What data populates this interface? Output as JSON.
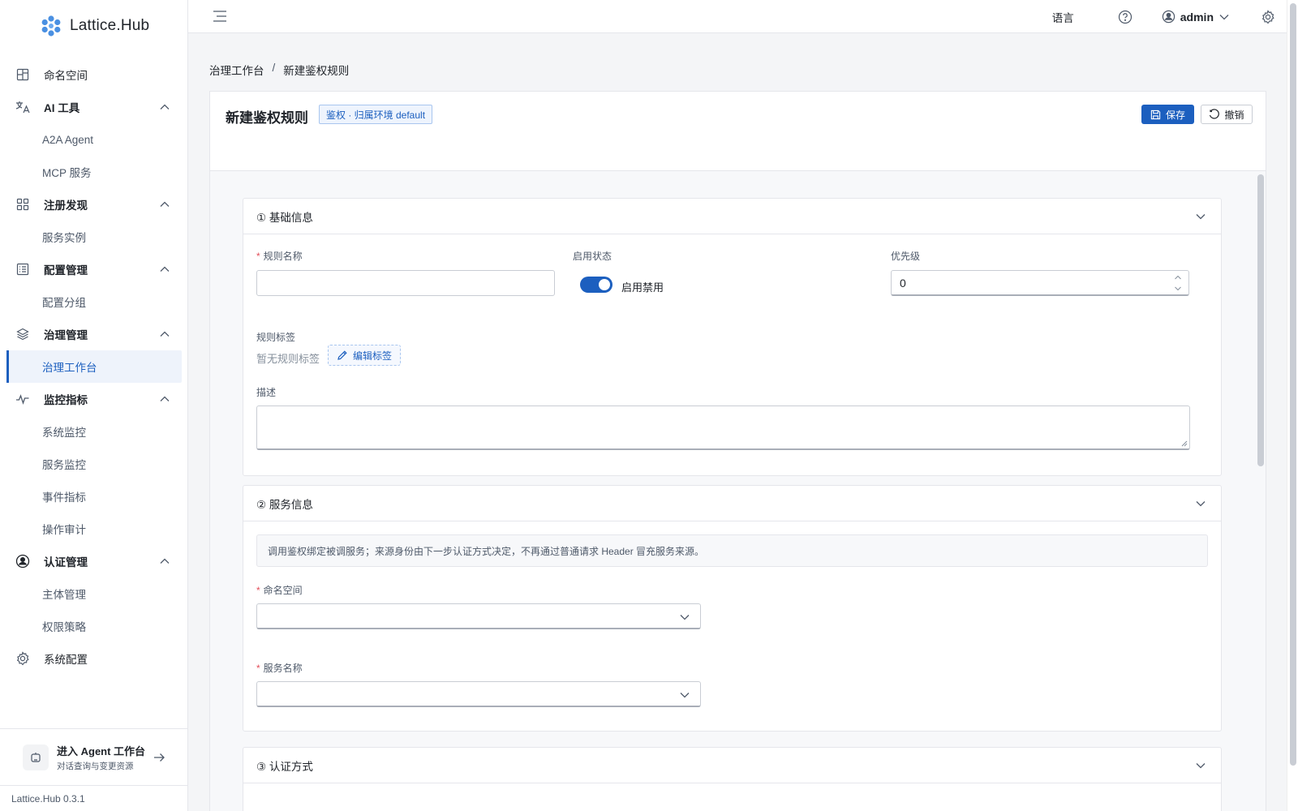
{
  "app": {
    "name": "Lattice.Hub",
    "version": "Lattice.Hub 0.3.1"
  },
  "sidebar": {
    "items": [
      {
        "label": "命名空间",
        "icon": "grid-icon",
        "type": "item"
      },
      {
        "label": "AI 工具",
        "icon": "translate-icon",
        "type": "group"
      },
      {
        "label": "A2A Agent",
        "type": "sub"
      },
      {
        "label": "MCP 服务",
        "type": "sub"
      },
      {
        "label": "注册发现",
        "icon": "apps-icon",
        "type": "group"
      },
      {
        "label": "服务实例",
        "type": "sub"
      },
      {
        "label": "配置管理",
        "icon": "list-icon",
        "type": "group"
      },
      {
        "label": "配置分组",
        "type": "sub"
      },
      {
        "label": "治理管理",
        "icon": "layers-icon",
        "type": "group"
      },
      {
        "label": "治理工作台",
        "type": "sub",
        "active": true
      },
      {
        "label": "监控指标",
        "icon": "pulse-icon",
        "type": "group"
      },
      {
        "label": "系统监控",
        "type": "sub"
      },
      {
        "label": "服务监控",
        "type": "sub"
      },
      {
        "label": "事件指标",
        "type": "sub"
      },
      {
        "label": "操作审计",
        "type": "sub"
      },
      {
        "label": "认证管理",
        "icon": "user-circle-icon",
        "type": "group"
      },
      {
        "label": "主体管理",
        "type": "sub"
      },
      {
        "label": "权限策略",
        "type": "sub"
      },
      {
        "label": "系统配置",
        "icon": "gear-icon",
        "type": "item"
      }
    ],
    "agent_entry": {
      "title": "进入 Agent 工作台",
      "subtitle": "对话查询与变更资源"
    }
  },
  "header": {
    "language": "语言",
    "user": "admin"
  },
  "breadcrumb": {
    "parent": "治理工作台",
    "separator": "/",
    "current": "新建鉴权规则"
  },
  "page": {
    "title": "新建鉴权规则",
    "tag": "鉴权 · 归属环境 default",
    "save_label": "保存",
    "cancel_label": "撤销"
  },
  "sections": {
    "basic": {
      "title": "① 基础信息",
      "rule_name_label": "规则名称",
      "rule_name_value": "",
      "status_label": "启用状态",
      "status_text": "启用禁用",
      "status_on": true,
      "priority_label": "优先级",
      "priority_value": "0",
      "tags_label": "规则标签",
      "tags_empty": "暂无规则标签",
      "edit_tags": "编辑标签",
      "desc_label": "描述"
    },
    "service": {
      "title": "② 服务信息",
      "notice": "调用鉴权绑定被调服务；来源身份由下一步认证方式决定，不再通过普通请求 Header 冒充服务来源。",
      "namespace_label": "命名空间",
      "service_label": "服务名称"
    },
    "auth": {
      "title": "③ 认证方式"
    }
  },
  "colors": {
    "accent": "#1c5fbf",
    "required": "#e34d59"
  }
}
